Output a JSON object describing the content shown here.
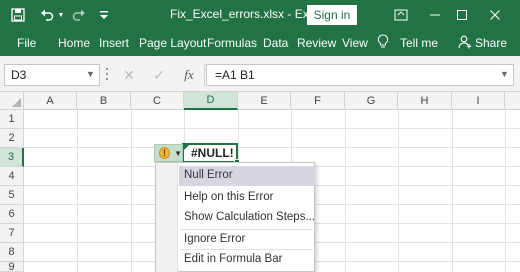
{
  "titlebar": {
    "filename": "Fix_Excel_errors.xlsx",
    "separator": "-",
    "app_name": "Excel",
    "signin_label": "Sign in",
    "quick_access": [
      "save-icon",
      "undo-icon",
      "undo-dropdown-icon",
      "redo-icon",
      "customize-icon"
    ],
    "window_controls": [
      "ribbon-display-icon",
      "minimize-icon",
      "maximize-icon",
      "close-icon"
    ]
  },
  "ribbon": {
    "tabs": [
      "File",
      "Home",
      "Insert",
      "Page Layout",
      "Formulas",
      "Data",
      "Review",
      "View"
    ],
    "tell_me": "Tell me",
    "share": "Share"
  },
  "formula_bar": {
    "name_box": "D3",
    "cancel_symbol": "✕",
    "enter_symbol": "✓",
    "fx_label": "fx",
    "formula": "=A1 B1"
  },
  "grid": {
    "columns": [
      "A",
      "B",
      "C",
      "D",
      "E",
      "F",
      "G",
      "H",
      "I"
    ],
    "rows": [
      "1",
      "2",
      "3",
      "4",
      "5",
      "6",
      "7",
      "8",
      "9"
    ],
    "selected_column": "D",
    "selected_row": "3",
    "active_cell_value": "#NULL!",
    "error_indicator_symbol": "!"
  },
  "error_menu": {
    "title": "Null Error",
    "items": [
      "Help on this Error",
      "Show Calculation Steps...",
      "Ignore Error",
      "Edit in Formula Bar"
    ]
  },
  "colors": {
    "accent": "#217346",
    "warning": "#f0b43c",
    "selected_header": "#d2e4d8"
  }
}
